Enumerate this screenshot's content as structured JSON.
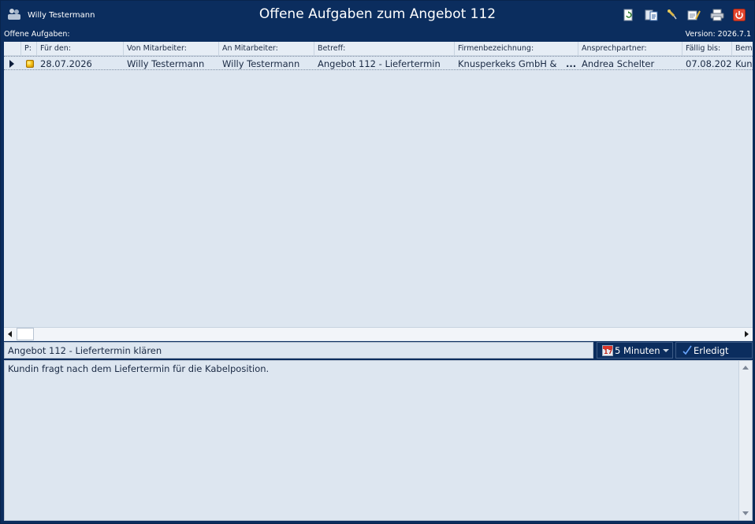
{
  "window": {
    "user_name": "Willy Testermann",
    "title": "Offene Aufgaben zum Angebot 112"
  },
  "toolbar": {
    "icons": [
      "document-refresh-icon",
      "document-copy-icon",
      "pin-icon",
      "edit-document-icon",
      "print-icon",
      "power-icon"
    ]
  },
  "subbar": {
    "left_label": "Offene Aufgaben:",
    "version": "Version: 2026.7.1"
  },
  "grid": {
    "columns": [
      "P:",
      "Für den:",
      "Von Mitarbeiter:",
      "An Mitarbeiter:",
      "Betreff:",
      "Firmenbezeichnung:",
      "Ansprechpartner:",
      "Fällig bis:",
      "Bem"
    ],
    "rows": [
      {
        "date": "28.07.2026",
        "from": "Willy Testermann",
        "to": "Willy Testermann",
        "subject": "Angebot 112 - Liefertermin",
        "company": "Knusperkeks GmbH &",
        "company_more": "...",
        "contact": "Andrea Schelter",
        "due": "07.08.202",
        "remark": "Kun"
      }
    ]
  },
  "detail": {
    "subject": "Angebot 112 - Liefertermin klären",
    "calendar_day": "17",
    "reminder": "5 Minuten",
    "done_label": "Erledigt",
    "note": "Kundin fragt nach dem Liefertermin für die Kabelposition."
  },
  "colors": {
    "frame": "#0b2d5e",
    "panel": "#dde6f0",
    "text": "#1a2a44"
  }
}
